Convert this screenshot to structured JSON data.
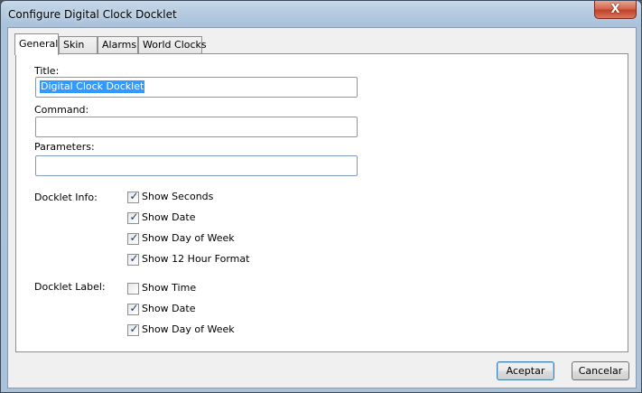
{
  "window": {
    "title": "Configure Digital Clock Docklet",
    "close_glyph": "X"
  },
  "tabs": [
    {
      "label": "General",
      "active": true
    },
    {
      "label": "Skin",
      "active": false
    },
    {
      "label": "Alarms",
      "active": false
    },
    {
      "label": "World Clocks",
      "active": false
    }
  ],
  "form": {
    "title_label": "Title:",
    "title_value": "Digital Clock Docklet",
    "command_label": "Command:",
    "command_value": "",
    "parameters_label": "Parameters:",
    "parameters_value": ""
  },
  "docklet_info": {
    "label": "Docklet Info:",
    "options": [
      {
        "label": "Show Seconds",
        "checked": true
      },
      {
        "label": "Show Date",
        "checked": true
      },
      {
        "label": "Show Day of Week",
        "checked": true
      },
      {
        "label": "Show 12 Hour Format",
        "checked": true
      }
    ]
  },
  "docklet_label": {
    "label": "Docklet Label:",
    "options": [
      {
        "label": "Show Time",
        "checked": false
      },
      {
        "label": "Show Date",
        "checked": true
      },
      {
        "label": "Show Day of Week",
        "checked": true
      }
    ]
  },
  "buttons": {
    "accept": "Aceptar",
    "cancel": "Cancelar"
  },
  "check_glyph": "✓"
}
